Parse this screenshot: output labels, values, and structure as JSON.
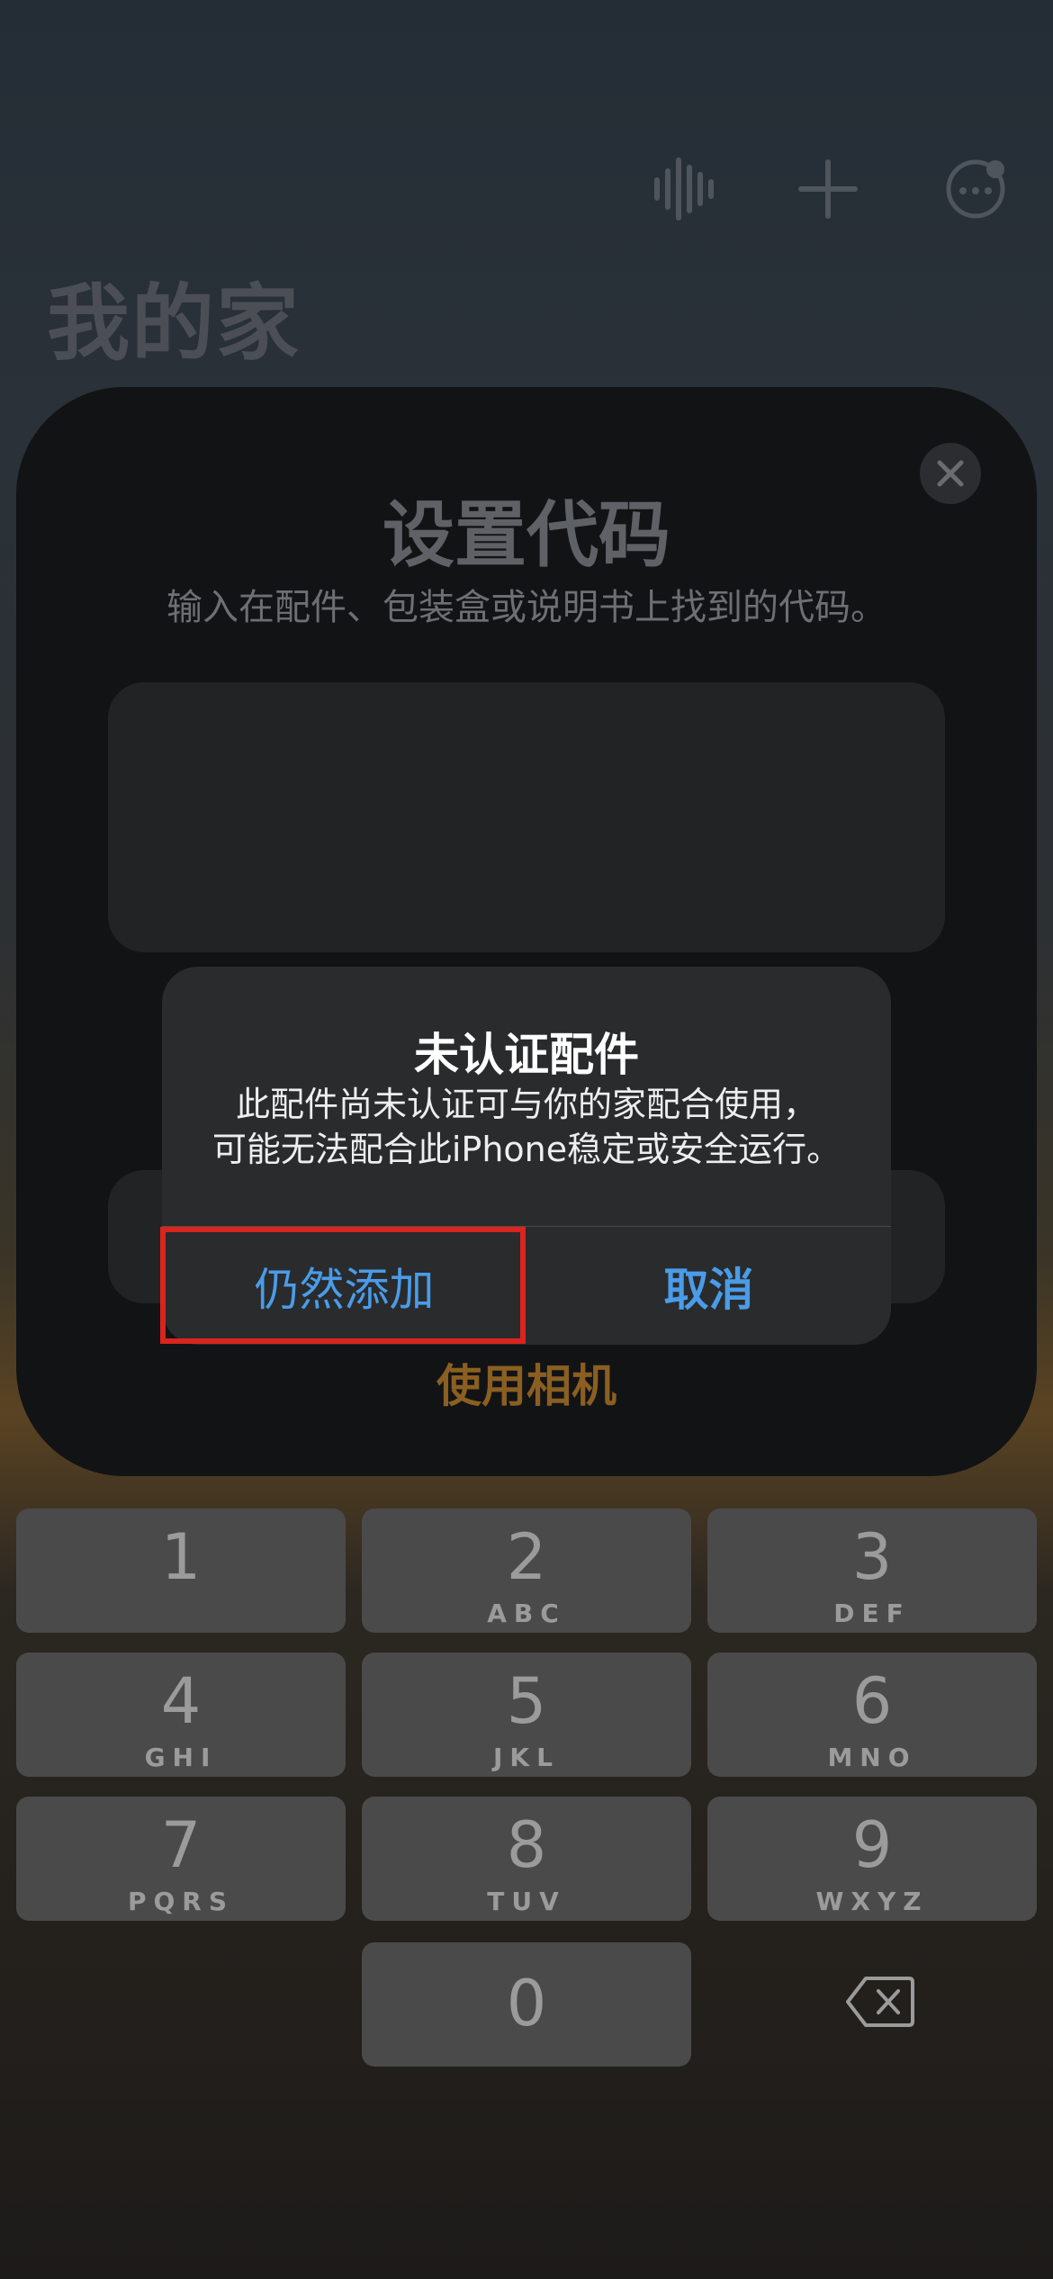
{
  "header": {
    "title": "我的家",
    "icons": [
      "waveform-icon",
      "plus-icon",
      "more-icon"
    ]
  },
  "sheet": {
    "title": "设置代码",
    "subtitle": "输入在配件、包装盒或说明书上找到的代码。",
    "camera_link": "使用相机"
  },
  "alert": {
    "title": "未认证配件",
    "message_line1": "此配件尚未认证可与你的家配合使用，",
    "message_line2": "可能无法配合此iPhone稳定或安全运行。",
    "add_anyway": "仍然添加",
    "cancel": "取消"
  },
  "keypad": {
    "keys": [
      {
        "num": "1",
        "letters": ""
      },
      {
        "num": "2",
        "letters": "ABC"
      },
      {
        "num": "3",
        "letters": "DEF"
      },
      {
        "num": "4",
        "letters": "GHI"
      },
      {
        "num": "5",
        "letters": "JKL"
      },
      {
        "num": "6",
        "letters": "MNO"
      },
      {
        "num": "7",
        "letters": "PQRS"
      },
      {
        "num": "8",
        "letters": "TUV"
      },
      {
        "num": "9",
        "letters": "WXYZ"
      },
      {
        "num": "0",
        "letters": ""
      }
    ]
  },
  "colors": {
    "accent_blue": "#4a9ce8",
    "highlight_red": "#d9251d",
    "camera_orange": "#8a5f21"
  }
}
